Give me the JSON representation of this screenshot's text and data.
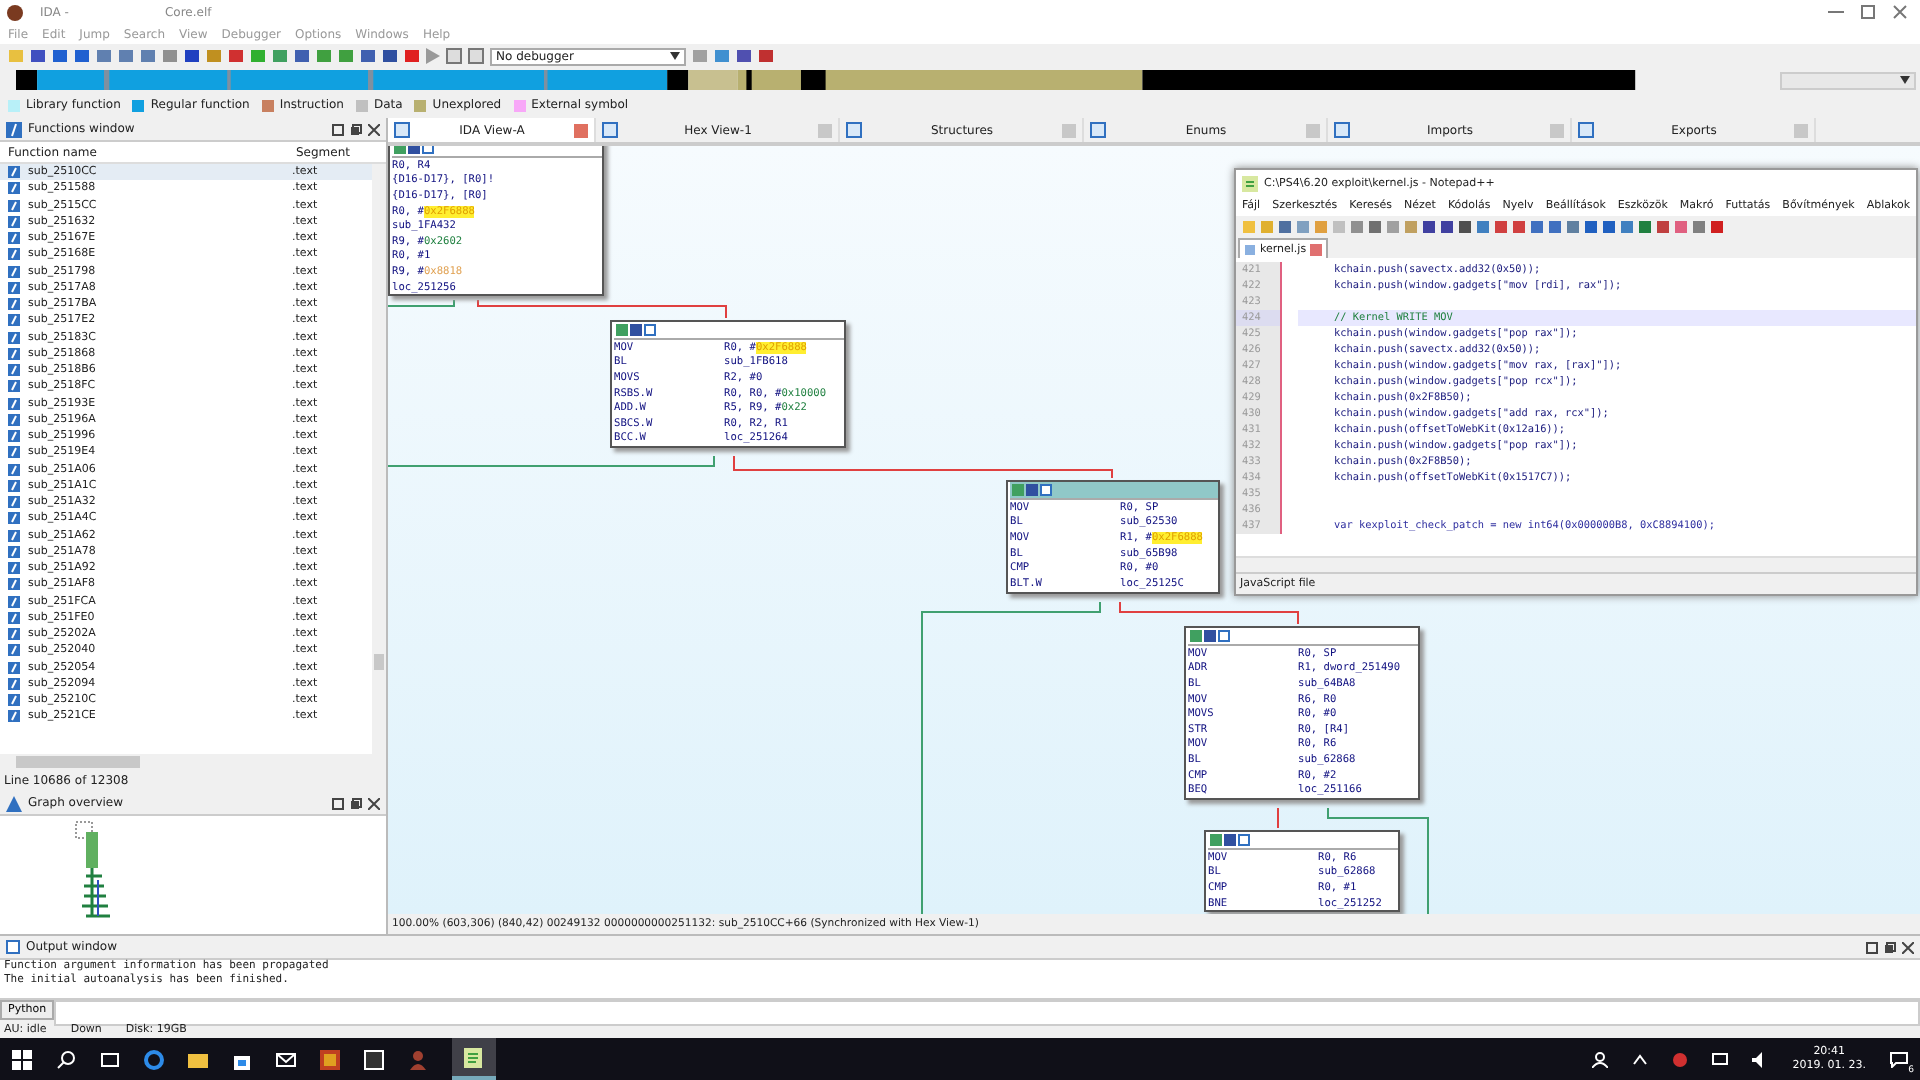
{
  "window": {
    "title": "IDA -",
    "file": "Core.elf"
  },
  "menu": [
    "File",
    "Edit",
    "Jump",
    "Search",
    "View",
    "Debugger",
    "Options",
    "Windows",
    "Help"
  ],
  "toolbar": {
    "debugger": "No debugger"
  },
  "legend": [
    {
      "label": "Library function",
      "color": "#b8f0f8"
    },
    {
      "label": "Regular function",
      "color": "#10a0e0"
    },
    {
      "label": "Instruction",
      "color": "#c88060"
    },
    {
      "label": "Data",
      "color": "#c0c0c0"
    },
    {
      "label": "Unexplored",
      "color": "#b8b070"
    },
    {
      "label": "External symbol",
      "color": "#f8a8f8"
    }
  ],
  "functions_window": {
    "title": "Functions window",
    "columns": [
      "Function name",
      "Segment"
    ],
    "rows": [
      {
        "name": "sub_2510CC",
        "segment": ".text",
        "selected": true
      },
      {
        "name": "sub_251588",
        "segment": ".text",
        "selected": false
      },
      {
        "name": "sub_2515CC",
        "segment": ".text",
        "selected": false
      },
      {
        "name": "sub_251632",
        "segment": ".text",
        "selected": false
      },
      {
        "name": "sub_25167E",
        "segment": ".text",
        "selected": false
      },
      {
        "name": "sub_25168E",
        "segment": ".text",
        "selected": false
      },
      {
        "name": "sub_251798",
        "segment": ".text",
        "selected": false
      },
      {
        "name": "sub_2517A8",
        "segment": ".text",
        "selected": false
      },
      {
        "name": "sub_2517BA",
        "segment": ".text",
        "selected": false
      },
      {
        "name": "sub_2517E2",
        "segment": ".text",
        "selected": false
      },
      {
        "name": "sub_25183C",
        "segment": ".text",
        "selected": false
      },
      {
        "name": "sub_251868",
        "segment": ".text",
        "selected": false
      },
      {
        "name": "sub_2518B6",
        "segment": ".text",
        "selected": false
      },
      {
        "name": "sub_2518FC",
        "segment": ".text",
        "selected": false
      },
      {
        "name": "sub_25193E",
        "segment": ".text",
        "selected": false
      },
      {
        "name": "sub_25196A",
        "segment": ".text",
        "selected": false
      },
      {
        "name": "sub_251996",
        "segment": ".text",
        "selected": false
      },
      {
        "name": "sub_2519E4",
        "segment": ".text",
        "selected": false
      },
      {
        "name": "sub_251A06",
        "segment": ".text",
        "selected": false
      },
      {
        "name": "sub_251A1C",
        "segment": ".text",
        "selected": false
      },
      {
        "name": "sub_251A32",
        "segment": ".text",
        "selected": false
      },
      {
        "name": "sub_251A4C",
        "segment": ".text",
        "selected": false
      },
      {
        "name": "sub_251A62",
        "segment": ".text",
        "selected": false
      },
      {
        "name": "sub_251A78",
        "segment": ".text",
        "selected": false
      },
      {
        "name": "sub_251A92",
        "segment": ".text",
        "selected": false
      },
      {
        "name": "sub_251AF8",
        "segment": ".text",
        "selected": false
      },
      {
        "name": "sub_251FCA",
        "segment": ".text",
        "selected": false
      },
      {
        "name": "sub_251FE0",
        "segment": ".text",
        "selected": false
      },
      {
        "name": "sub_25202A",
        "segment": ".text",
        "selected": false
      },
      {
        "name": "sub_252040",
        "segment": ".text",
        "selected": false
      },
      {
        "name": "sub_252054",
        "segment": ".text",
        "selected": false
      },
      {
        "name": "sub_252094",
        "segment": ".text",
        "selected": false
      },
      {
        "name": "sub_25210C",
        "segment": ".text",
        "selected": false
      },
      {
        "name": "sub_2521CE",
        "segment": ".text",
        "selected": false
      }
    ],
    "status": "Line 10686 of 12308"
  },
  "graph_overview": {
    "title": "Graph overview"
  },
  "tabs": [
    {
      "label": "IDA View-A",
      "selected": true
    },
    {
      "label": "Hex View-1",
      "selected": false
    },
    {
      "label": "Structures",
      "selected": false
    },
    {
      "label": "Enums",
      "selected": false
    },
    {
      "label": "Imports",
      "selected": false
    },
    {
      "label": "Exports",
      "selected": false
    }
  ],
  "graph": {
    "nodes": [
      {
        "selected": false,
        "lines": [
          {
            "args": "R0, R4"
          },
          {
            "args": "{D16-D17}, [R0]!"
          },
          {
            "args": "{D16-D17}, [R0]"
          },
          {
            "args": "R0, #",
            "imm": "0x2F6888",
            "kind": "highlight"
          },
          {
            "args": "sub_1FA432"
          },
          {
            "args": "R9, #",
            "imm": "0x2602",
            "kind": "number"
          },
          {
            "args": "R0, #1"
          },
          {
            "args": "R9, #",
            "imm": "0x8818",
            "kind": "data"
          },
          {
            "args": "loc_251256"
          }
        ]
      },
      {
        "selected": false,
        "lines": [
          {
            "op": "MOV",
            "args": "R0, #",
            "imm": "0x2F6888",
            "kind": "highlight"
          },
          {
            "op": "BL",
            "args": "sub_1FB618"
          },
          {
            "op": "MOVS",
            "args": "R2, #0"
          },
          {
            "op": "RSBS.W",
            "args": "R0, R0, #",
            "imm": "0x10000",
            "kind": "number"
          },
          {
            "op": "ADD.W",
            "args": "R5, R9, #",
            "imm": "0x22",
            "kind": "number"
          },
          {
            "op": "SBCS.W",
            "args": "R0, R2, R1"
          },
          {
            "op": "BCC.W",
            "args": "loc_251264"
          }
        ]
      },
      {
        "selected": true,
        "lines": [
          {
            "op": "MOV",
            "args": "R0, SP"
          },
          {
            "op": "BL",
            "args": "sub_62530"
          },
          {
            "op": "MOV",
            "args": "R1, #",
            "imm": "0x2F6888",
            "kind": "highlight"
          },
          {
            "op": "BL",
            "args": "sub_65B98"
          },
          {
            "op": "CMP",
            "args": "R0, #0"
          },
          {
            "op": "BLT.W",
            "args": "loc_25125C"
          }
        ]
      },
      {
        "selected": false,
        "lines": [
          {
            "op": "MOV",
            "args": "R0, SP"
          },
          {
            "op": "ADR",
            "args": "R1, dword_251490"
          },
          {
            "op": "BL",
            "args": "sub_64BA8"
          },
          {
            "op": "MOV",
            "args": "R6, R0"
          },
          {
            "op": "MOVS",
            "args": "R0, #0"
          },
          {
            "op": "STR",
            "args": "R0, [R4]"
          },
          {
            "op": "MOV",
            "args": "R0, R6"
          },
          {
            "op": "BL",
            "args": "sub_62868"
          },
          {
            "op": "CMP",
            "args": "R0, #2"
          },
          {
            "op": "BEQ",
            "args": "loc_251166"
          }
        ]
      },
      {
        "selected": false,
        "lines": [
          {
            "op": "MOV",
            "args": "R0, R6"
          },
          {
            "op": "BL",
            "args": "sub_62868"
          },
          {
            "op": "CMP",
            "args": "R0, #1"
          },
          {
            "op": "BNE",
            "args": "loc_251252"
          }
        ]
      }
    ]
  },
  "status_line": "100.00% (603,306) (840,42) 00249132 0000000000251132: sub_2510CC+66 (Synchronized with Hex View-1)",
  "notepad": {
    "title": "C:\\PS4\\6.20 exploit\\kernel.js - Notepad++",
    "menu": [
      "Fájl",
      "Szerkesztés",
      "Keresés",
      "Nézet",
      "Kódolás",
      "Nyelv",
      "Beállítások",
      "Eszközök",
      "Makró",
      "Futtatás",
      "Bővítmények",
      "Ablakok"
    ],
    "tab": "kernel.js",
    "lines": [
      {
        "number": "421",
        "text": "kchain.push(savectx.add32(0x50));",
        "kind": "code",
        "current": false
      },
      {
        "number": "422",
        "text": "kchain.push(window.gadgets[\"mov [rdi], rax\"]);",
        "kind": "code",
        "current": false
      },
      {
        "number": "423",
        "current": false
      },
      {
        "number": "424",
        "text": "//  Kernel WRITE MOV",
        "kind": "comment",
        "current": true
      },
      {
        "number": "425",
        "text": "kchain.push(window.gadgets[\"pop rax\"]);",
        "kind": "code",
        "current": false
      },
      {
        "number": "426",
        "text": "kchain.push(savectx.add32(0x50));",
        "kind": "code",
        "current": false
      },
      {
        "number": "427",
        "text": "kchain.push(window.gadgets[\"mov rax, [rax]\"]);",
        "kind": "code",
        "current": false
      },
      {
        "number": "428",
        "text": "kchain.push(window.gadgets[\"pop rcx\"]);",
        "kind": "code",
        "current": false
      },
      {
        "number": "429",
        "text": "kchain.push(0x2F8B50);",
        "kind": "code",
        "current": false
      },
      {
        "number": "430",
        "text": "kchain.push(window.gadgets[\"add rax, rcx\"]);",
        "kind": "code",
        "current": false
      },
      {
        "number": "431",
        "text": "kchain.push(offsetToWebKit(0x12a16));",
        "kind": "code",
        "current": false
      },
      {
        "number": "432",
        "text": "kchain.push(window.gadgets[\"pop rax\"]);",
        "kind": "code",
        "current": false
      },
      {
        "number": "433",
        "text": "kchain.push(0x2F8B50);",
        "kind": "code",
        "current": false
      },
      {
        "number": "434",
        "text": "kchain.push(offsetToWebKit(0x1517C7));",
        "kind": "code",
        "current": false
      },
      {
        "number": "435",
        "current": false
      },
      {
        "number": "436",
        "current": false
      },
      {
        "number": "437",
        "text": "var kexploit_check_patch = new int64(0x000000B8, 0xC8894100);",
        "kind": "decl",
        "current": false
      }
    ],
    "status": "JavaScript file"
  },
  "output_window": {
    "title": "Output window",
    "lines": [
      "Function argument information has been propagated",
      "The initial autoanalysis has been finished."
    ],
    "button": "Python"
  },
  "status_bar": [
    "AU:  idle",
    "Down",
    "Disk: 19GB"
  ],
  "taskbar": {
    "time": "20:41",
    "date": "2019. 01. 23.",
    "notifications": "6"
  }
}
